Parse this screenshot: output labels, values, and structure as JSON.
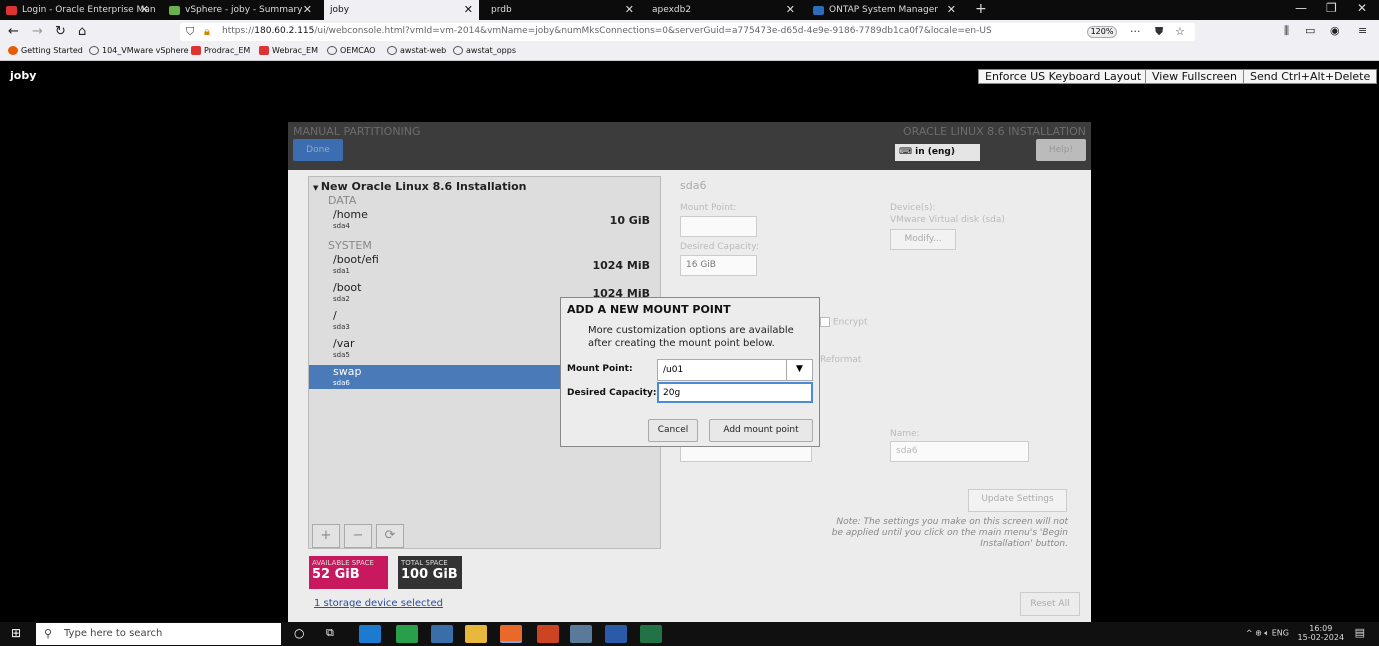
{
  "browser": {
    "tabs": [
      {
        "label": "Login - Oracle Enterprise Mana",
        "color": "#d33"
      },
      {
        "label": "vSphere - joby - Summary",
        "color": "#6ab04c"
      },
      {
        "label": "joby",
        "color": ""
      },
      {
        "label": "prdb",
        "color": ""
      },
      {
        "label": "apexdb2",
        "color": ""
      },
      {
        "label": "ONTAP System Manager",
        "color": "#2a6ebb"
      }
    ],
    "url_host": "180.60.2.115",
    "url_path": "/ui/webconsole.html?vmId=vm-2014&vmName=joby&numMksConnections=0&serverGuid=a775473e-d65d-4e9e-9186-7789db1ca0f7&locale=en-US",
    "url_prefix": "https://",
    "zoom": "120%",
    "bookmarks": [
      {
        "label": "Getting Started",
        "color": "#e65c00"
      },
      {
        "label": "104_VMware vSphere",
        "color": "#555"
      },
      {
        "label": "Prodrac_EM",
        "color": "#d33"
      },
      {
        "label": "Webrac_EM",
        "color": "#d33"
      },
      {
        "label": "OEMCAO",
        "color": "#555"
      },
      {
        "label": "awstat-web",
        "color": "#555"
      },
      {
        "label": "awstat_opps",
        "color": "#555"
      }
    ]
  },
  "console": {
    "vm_name": "joby",
    "enforce_keyboard": "Enforce US Keyboard Layout",
    "view_fullscreen": "View Fullscreen",
    "send_cad": "Send Ctrl+Alt+Delete"
  },
  "installer": {
    "title": "MANUAL PARTITIONING",
    "product": "ORACLE LINUX 8.6 INSTALLATION",
    "done": "Done",
    "keyboard": "in (eng)",
    "help": "Help!",
    "tree_title": "New Oracle Linux 8.6 Installation",
    "groups": {
      "data": "DATA",
      "system": "SYSTEM"
    },
    "mounts": [
      {
        "mount": "/home",
        "device": "sda4",
        "size": "10 GiB"
      },
      {
        "mount": "/boot/efi",
        "device": "sda1",
        "size": "1024 MiB"
      },
      {
        "mount": "/boot",
        "device": "sda2",
        "size": "1024 MiB"
      },
      {
        "mount": "/",
        "device": "sda3",
        "size": ""
      },
      {
        "mount": "/var",
        "device": "sda5",
        "size": ""
      },
      {
        "mount": "swap",
        "device": "sda6",
        "size": ""
      }
    ],
    "available_label": "AVAILABLE SPACE",
    "available_value": "52 GiB",
    "total_label": "TOTAL SPACE",
    "total_value": "100 GiB",
    "storage_link": "1 storage device selected",
    "right": {
      "heading": "sda6",
      "mount_point_label": "Mount Point:",
      "desired_capacity_label": "Desired Capacity:",
      "desired_capacity_value": "16 GiB",
      "devices_label": "Device(s):",
      "device_value": "VMware Virtual disk (sda)",
      "modify": "Modify...",
      "encrypt": "Encrypt",
      "reformat": "Reformat",
      "name_label": "Name:",
      "name_value": "sda6",
      "update": "Update Settings",
      "note": "Note:  The settings you make on this screen will not be applied until you click on the main menu's 'Begin Installation' button.",
      "reset": "Reset All"
    }
  },
  "dialog": {
    "title": "ADD A NEW MOUNT POINT",
    "info": "More customization options are available after creating the mount point below.",
    "mount_label": "Mount Point:",
    "mount_value": "/u01",
    "capacity_label": "Desired Capacity:",
    "capacity_value": "20g",
    "cancel": "Cancel",
    "add": "Add mount point"
  },
  "taskbar": {
    "search_placeholder": "Type here to search",
    "lang": "ENG",
    "time": "16:09",
    "date": "15-02-2024"
  }
}
